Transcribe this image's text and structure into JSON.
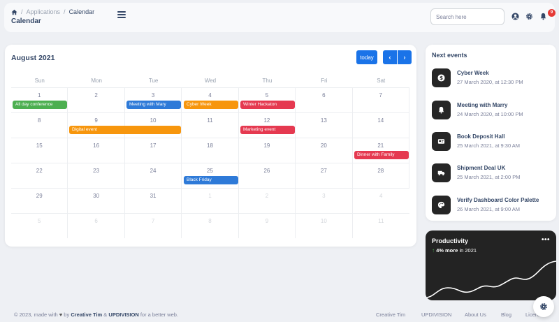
{
  "breadcrumb": {
    "applications": "Applications",
    "separator": "/",
    "current": "Calendar"
  },
  "page_title": "Calendar",
  "search": {
    "placeholder": "Search here",
    "value": ""
  },
  "notifications": {
    "count": "9"
  },
  "calendar": {
    "title": "August 2021",
    "today_label": "today",
    "prev_label": "‹",
    "next_label": "›",
    "weekdays": [
      "Sun",
      "Mon",
      "Tue",
      "Wed",
      "Thu",
      "Fri",
      "Sat"
    ],
    "weeks": [
      [
        "1",
        "2",
        "3",
        "4",
        "5",
        "6",
        "7"
      ],
      [
        "8",
        "9",
        "10",
        "11",
        "12",
        "13",
        "14"
      ],
      [
        "15",
        "16",
        "17",
        "18",
        "19",
        "20",
        "21"
      ],
      [
        "22",
        "23",
        "24",
        "25",
        "26",
        "27",
        "28"
      ],
      [
        "29",
        "30",
        "31",
        "1",
        "2",
        "3",
        "4"
      ],
      [
        "5",
        "6",
        "7",
        "8",
        "9",
        "10",
        "11"
      ]
    ],
    "events": {
      "all_day": "All day conference",
      "meeting": "Meeting with Mary",
      "cyber": "Cyber Week",
      "winter": "Winter Hackaton",
      "digital": "Digital event",
      "marketing": "Marketing event",
      "dinner": "Dinner with Family",
      "black_friday": "Black Friday"
    },
    "colors": {
      "green": "#4caf50",
      "blue": "#2e7ad8",
      "orange": "#f7960d",
      "red": "#e53950",
      "button": "#1a73e8"
    }
  },
  "next_events": {
    "title": "Next events",
    "items": [
      {
        "name": "Cyber Week",
        "date": "27 March 2020, at 12:30 PM",
        "icon": "dollar-icon"
      },
      {
        "name": "Meeting with Marry",
        "date": "24 March 2020, at 10:00 PM",
        "icon": "bell-icon"
      },
      {
        "name": "Book Deposit Hall",
        "date": "25 March 2021, at 9:30 AM",
        "icon": "card-icon"
      },
      {
        "name": "Shipment Deal UK",
        "date": "25 March 2021, at 2:00 PM",
        "icon": "truck-icon"
      },
      {
        "name": "Verify Dashboard Color Palette",
        "date": "26 March 2021, at 9:00 AM",
        "icon": "palette-icon"
      }
    ]
  },
  "productivity": {
    "title": "Productivity",
    "percent": "4% more",
    "suffix": "in 2021",
    "arrow": "↑",
    "more": "•••"
  },
  "footer": {
    "copyright_prefix": "© 2023, made with",
    "by": "by",
    "creative_tim": "Creative Tim",
    "amp": "&",
    "updivision": "UPDIVISION",
    "suffix": "for a better web.",
    "links": [
      "Creative Tim",
      "UPDIVISION",
      "About Us",
      "Blog",
      "License"
    ]
  }
}
